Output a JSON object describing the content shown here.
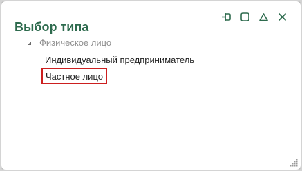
{
  "dialog": {
    "title": "Выбор типа",
    "controls": [
      {
        "icon": "pin-icon"
      },
      {
        "icon": "maximize-icon"
      },
      {
        "icon": "collapse-icon"
      },
      {
        "icon": "close-icon"
      }
    ]
  },
  "tree": {
    "group_label": "Физическое лицо",
    "group_expanded": true,
    "items": [
      {
        "label": "Индивидуальный предприниматель",
        "selected": false
      },
      {
        "label": "Частное лицо",
        "selected": true
      }
    ]
  },
  "colors": {
    "title": "#2e6b4e",
    "group_label": "#8f8f8f",
    "selection_border": "#cc1f1f",
    "control_icon": "#2e6b4e"
  }
}
